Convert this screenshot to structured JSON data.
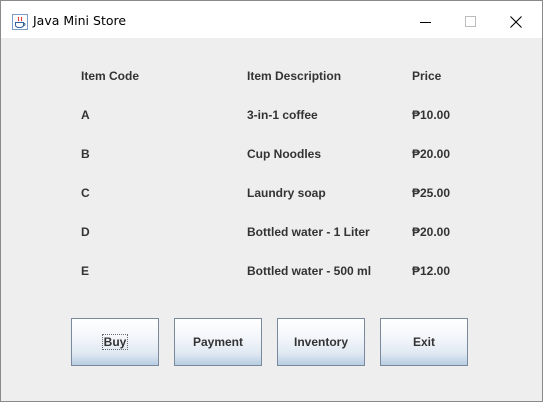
{
  "window": {
    "title": "Java Mini Store",
    "icon": "java-cup-icon",
    "controls": {
      "minimize_icon": "minimize-icon",
      "maximize_icon": "maximize-icon",
      "close_icon": "close-icon"
    }
  },
  "table": {
    "headers": {
      "code": "Item Code",
      "description": "Item Description",
      "price": "Price"
    },
    "rows": [
      {
        "code": "A",
        "description": "3-in-1 coffee",
        "price": "₱10.00"
      },
      {
        "code": "B",
        "description": "Cup Noodles",
        "price": "₱20.00"
      },
      {
        "code": "C",
        "description": "Laundry soap",
        "price": "₱25.00"
      },
      {
        "code": "D",
        "description": "Bottled water - 1 Liter",
        "price": "₱20.00"
      },
      {
        "code": "E",
        "description": "Bottled water - 500 ml",
        "price": "₱12.00"
      }
    ]
  },
  "buttons": {
    "buy": "Buy",
    "payment": "Payment",
    "inventory": "Inventory",
    "exit": "Exit"
  },
  "colors": {
    "panel_background": "#eeeeee",
    "text": "#333333",
    "button_border": "#7a8a9c"
  }
}
